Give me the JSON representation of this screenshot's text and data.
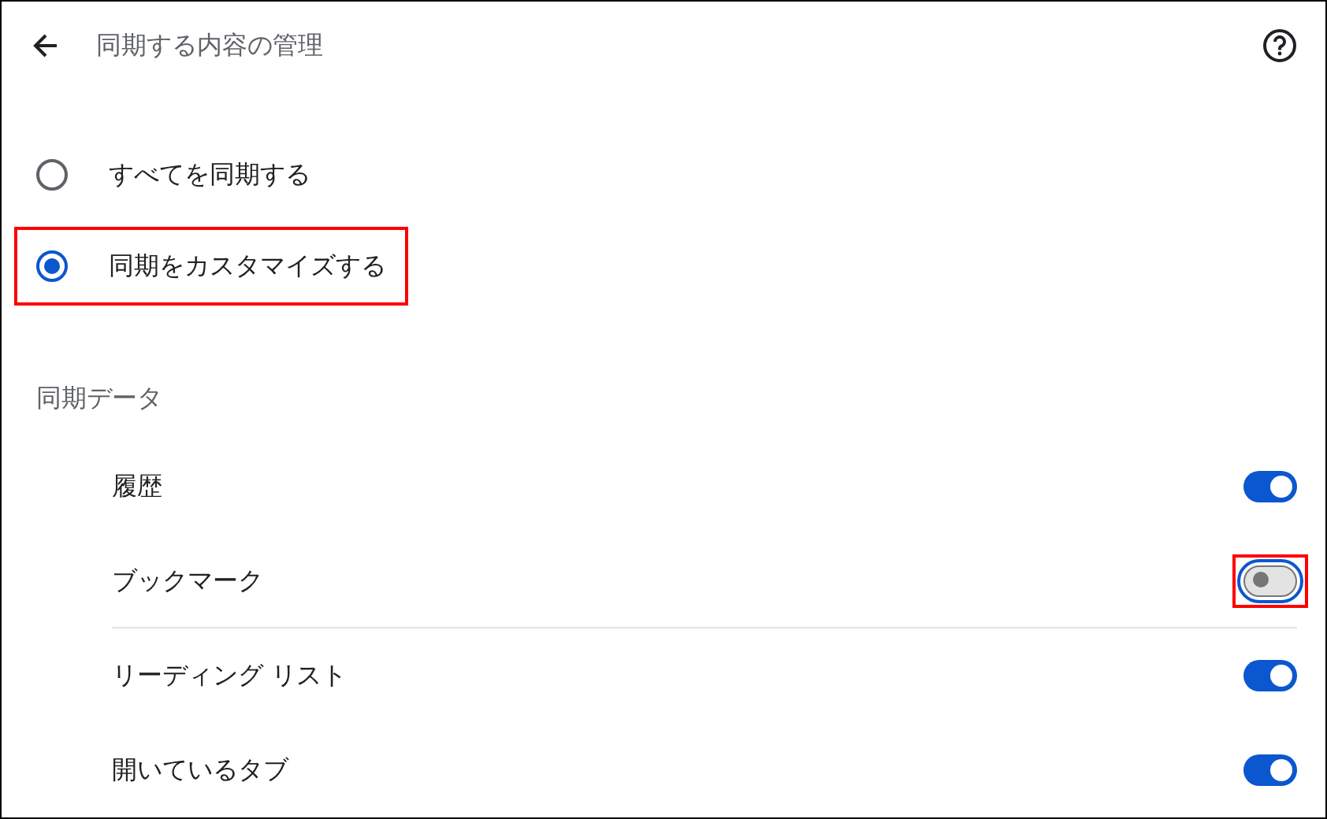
{
  "header": {
    "title": "同期する内容の管理"
  },
  "sync_options": [
    {
      "label": "すべてを同期する",
      "selected": false,
      "highlighted": false
    },
    {
      "label": "同期をカスタマイズする",
      "selected": true,
      "highlighted": true
    }
  ],
  "section": {
    "title": "同期データ"
  },
  "items": [
    {
      "label": "履歴",
      "on": true,
      "focused": false,
      "highlighted": false,
      "divider": false
    },
    {
      "label": "ブックマーク",
      "on": false,
      "focused": true,
      "highlighted": true,
      "divider": true
    },
    {
      "label": "リーディング リスト",
      "on": true,
      "focused": false,
      "highlighted": false,
      "divider": false
    },
    {
      "label": "開いているタブ",
      "on": true,
      "focused": false,
      "highlighted": false,
      "divider": false
    }
  ]
}
